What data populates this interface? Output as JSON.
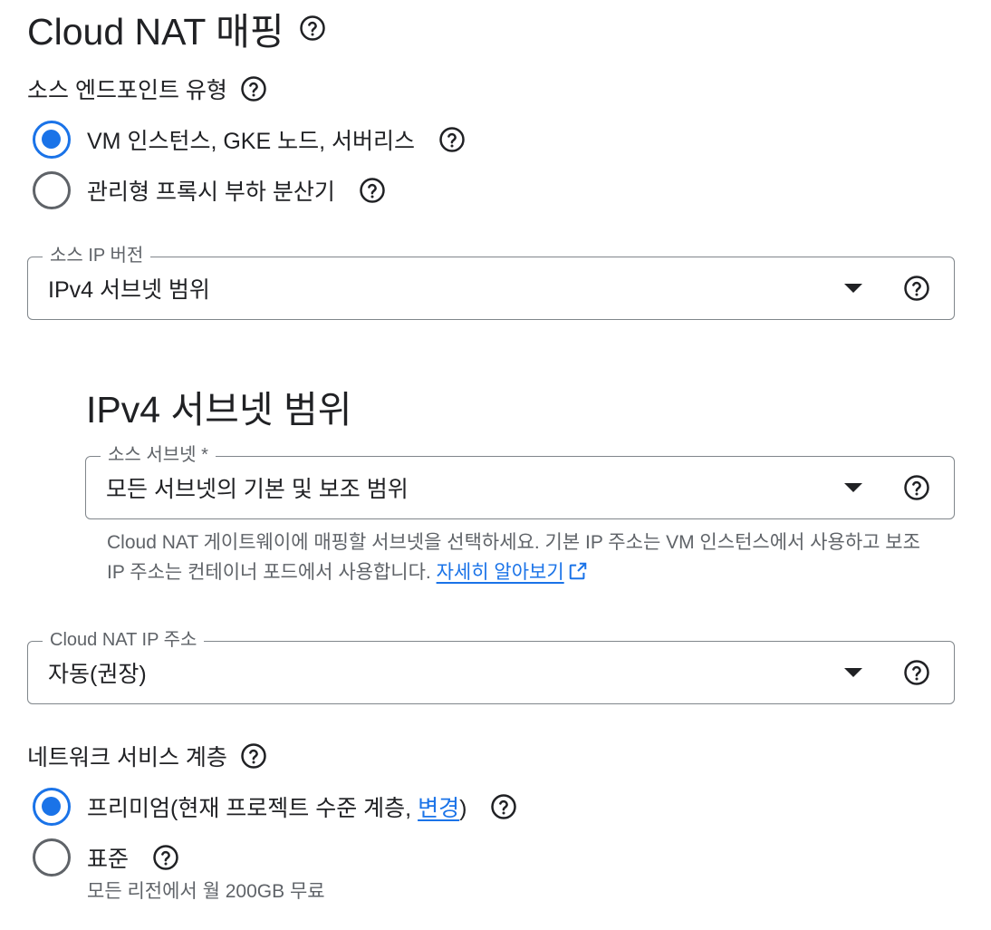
{
  "title": "Cloud NAT 매핑",
  "source_endpoint": {
    "label": "소스 엔드포인트 유형",
    "options": [
      {
        "label": "VM 인스턴스, GKE 노드, 서버리스",
        "checked": true
      },
      {
        "label": "관리형 프록시 부하 분산기",
        "checked": false
      }
    ]
  },
  "source_ip_version": {
    "legend": "소스 IP 버전",
    "value": "IPv4 서브넷 범위"
  },
  "ipv4_section": {
    "heading": "IPv4 서브넷 범위",
    "source_subnet": {
      "legend": "소스 서브넷 *",
      "value": "모든 서브넷의 기본 및 보조 범위"
    },
    "hint_text": "Cloud NAT 게이트웨이에 매핑할 서브넷을 선택하세요. 기본 IP 주소는 VM 인스턴스에서 사용하고 보조 IP 주소는 컨테이너 포드에서 사용합니다.",
    "learn_more": "자세히 알아보기"
  },
  "nat_ip": {
    "legend": "Cloud NAT IP 주소",
    "value": "자동(권장)"
  },
  "network_tier": {
    "label": "네트워크 서비스 계층",
    "premium_prefix": "프리미엄(현재 프로젝트 수준 계층, ",
    "premium_link": "변경",
    "premium_suffix": ")",
    "standard_label": "표준",
    "standard_desc": "모든 리전에서 월 200GB 무료",
    "premium_checked": true
  },
  "colors": {
    "accent": "#1a73e8",
    "text": "#202124",
    "secondary_text": "#5f6368"
  },
  "icons": [
    "help-icon",
    "dropdown-caret-icon",
    "external-link-icon"
  ]
}
